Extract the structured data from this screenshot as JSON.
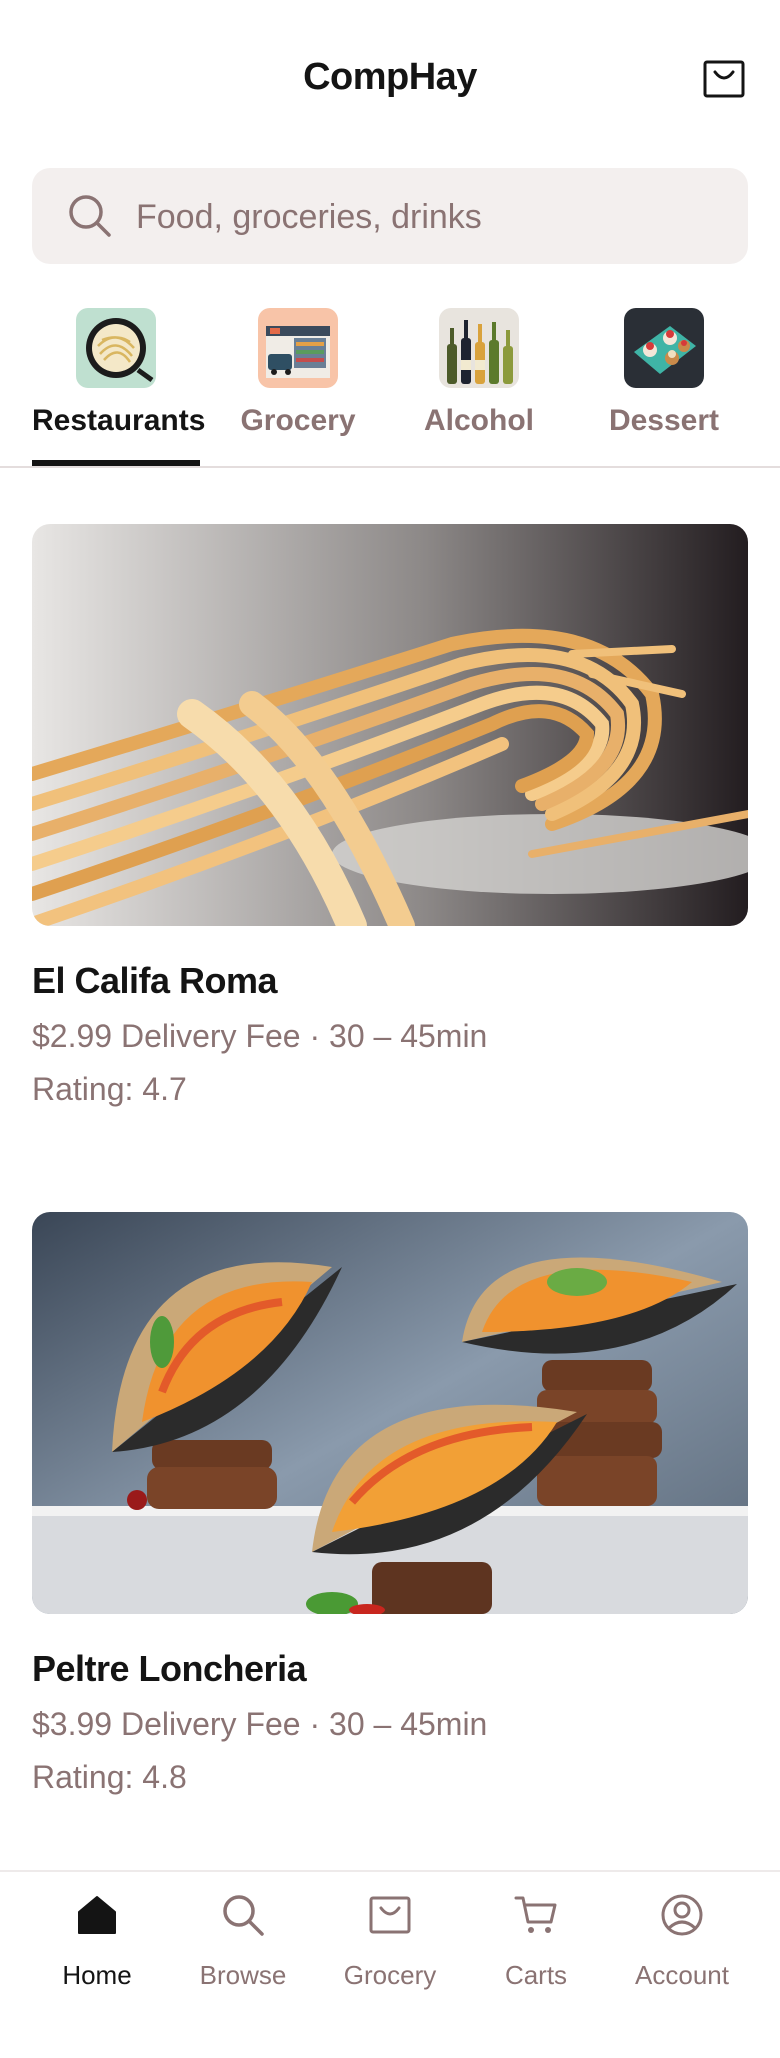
{
  "header": {
    "title": "CompHay",
    "cart_icon": "shopping-bag-icon"
  },
  "search": {
    "placeholder": "Food, groceries, drinks",
    "icon": "search-icon"
  },
  "categories": [
    {
      "label": "Restaurants",
      "icon": "pasta-bowl-icon",
      "active": true
    },
    {
      "label": "Grocery",
      "icon": "grocery-store-icon",
      "active": false
    },
    {
      "label": "Alcohol",
      "icon": "wine-bottles-icon",
      "active": false
    },
    {
      "label": "Dessert",
      "icon": "cupcakes-icon",
      "active": false
    }
  ],
  "restaurants": [
    {
      "name": "El Califa Roma",
      "fee_line": "$2.99 Delivery Fee · 30 – 45min",
      "rating": "Rating: 4.7",
      "photo": "spaghetti-photo"
    },
    {
      "name": "Peltre Loncheria",
      "fee_line": "$3.99 Delivery Fee · 30 – 45min",
      "rating": "Rating: 4.8",
      "photo": "tacos-photo"
    }
  ],
  "bottom_nav": [
    {
      "label": "Home",
      "icon": "home-icon",
      "active": true
    },
    {
      "label": "Browse",
      "icon": "search-icon",
      "active": false
    },
    {
      "label": "Grocery",
      "icon": "shopping-bag-icon",
      "active": false
    },
    {
      "label": "Carts",
      "icon": "cart-icon",
      "active": false
    },
    {
      "label": "Account",
      "icon": "account-icon",
      "active": false
    }
  ],
  "colors": {
    "text": "#141414",
    "muted": "#8a7373",
    "search_bg": "#f3efee"
  }
}
